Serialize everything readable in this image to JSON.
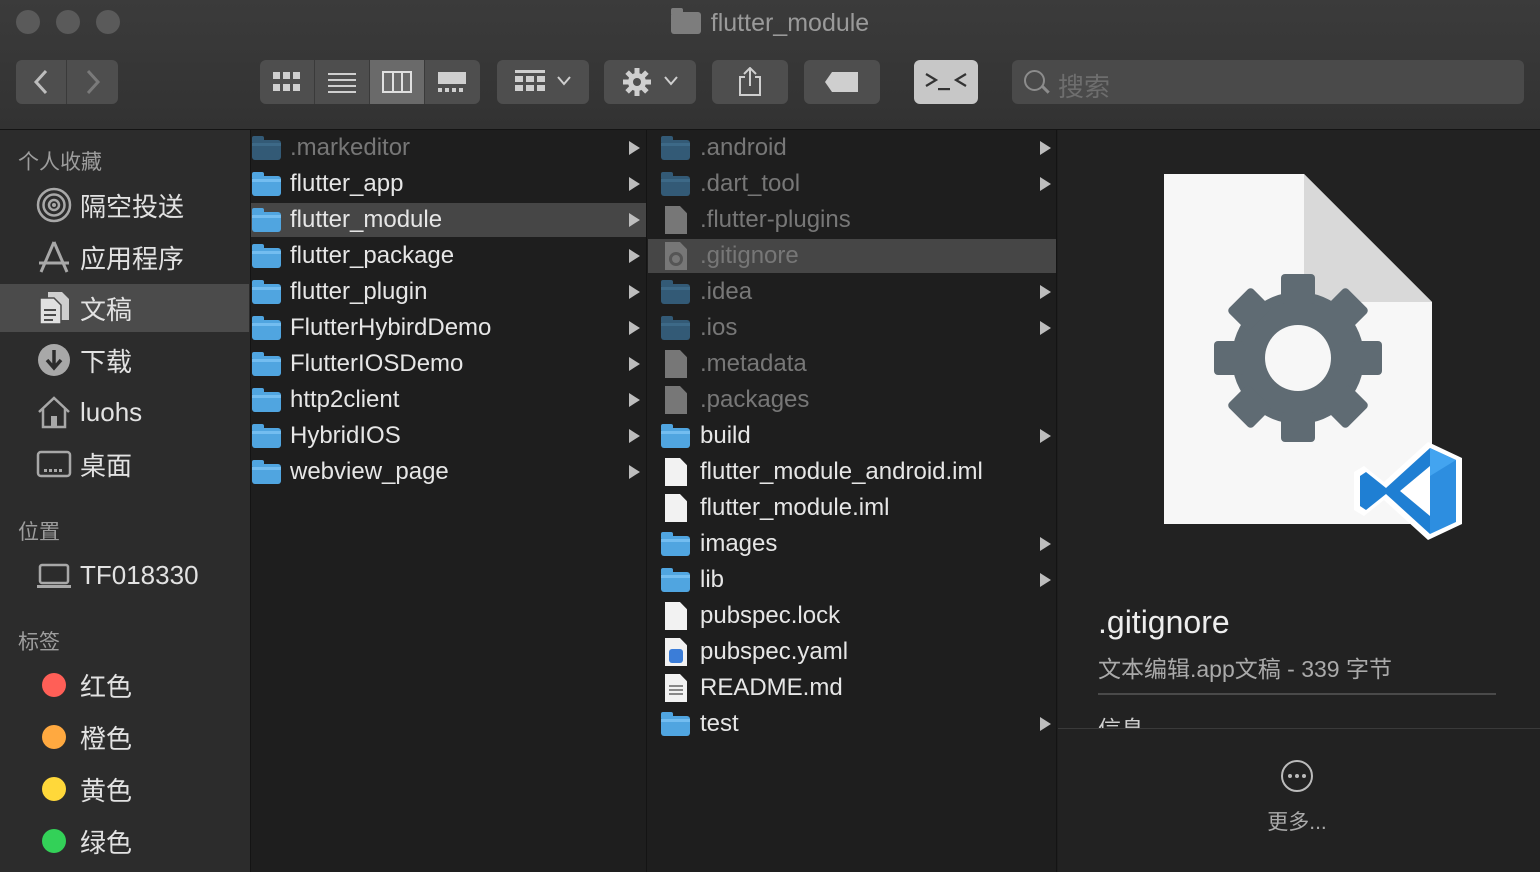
{
  "window": {
    "title": "flutter_module"
  },
  "toolbar": {
    "back_icon": "chevron-left",
    "forward_icon": "chevron-right",
    "view_modes": [
      "icon-view",
      "list-view",
      "column-view",
      "gallery-view"
    ],
    "selected_view": "column-view",
    "search_placeholder": "搜索"
  },
  "sidebar": {
    "favorites_header": "个人收藏",
    "favorites": [
      {
        "label": "隔空投送",
        "icon": "airdrop-icon"
      },
      {
        "label": "应用程序",
        "icon": "applications-icon"
      },
      {
        "label": "文稿",
        "icon": "documents-icon",
        "selected": true
      },
      {
        "label": "下载",
        "icon": "downloads-icon"
      },
      {
        "label": "luohs",
        "icon": "home-icon"
      },
      {
        "label": "桌面",
        "icon": "desktop-icon"
      }
    ],
    "locations_header": "位置",
    "locations": [
      {
        "label": "TF018330",
        "icon": "laptop-icon"
      }
    ],
    "tags_header": "标签",
    "tags": [
      {
        "label": "红色",
        "color": "#ff5f57"
      },
      {
        "label": "橙色",
        "color": "#ffa940"
      },
      {
        "label": "黄色",
        "color": "#ffd83a"
      },
      {
        "label": "绿色",
        "color": "#33d158"
      }
    ]
  },
  "column1": [
    {
      "name": ".markeditor",
      "type": "folder",
      "hidden": true,
      "arrow": true
    },
    {
      "name": "flutter_app",
      "type": "folder",
      "arrow": true
    },
    {
      "name": "flutter_module",
      "type": "folder",
      "arrow": true,
      "selected": true
    },
    {
      "name": "flutter_package",
      "type": "folder",
      "arrow": true
    },
    {
      "name": "flutter_plugin",
      "type": "folder",
      "arrow": true
    },
    {
      "name": "FlutterHybirdDemo",
      "type": "folder",
      "arrow": true
    },
    {
      "name": "FlutterIOSDemo",
      "type": "folder",
      "arrow": true
    },
    {
      "name": "http2client",
      "type": "folder",
      "arrow": true
    },
    {
      "name": "HybridIOS",
      "type": "folder",
      "arrow": true
    },
    {
      "name": "webview_page",
      "type": "folder",
      "arrow": true
    }
  ],
  "column2": [
    {
      "name": ".android",
      "type": "folder",
      "hidden": true,
      "arrow": true
    },
    {
      "name": ".dart_tool",
      "type": "folder",
      "hidden": true,
      "arrow": true
    },
    {
      "name": ".flutter-plugins",
      "type": "file",
      "hidden": true
    },
    {
      "name": ".gitignore",
      "type": "config-file",
      "hidden": true,
      "selected": true
    },
    {
      "name": ".idea",
      "type": "folder",
      "hidden": true,
      "arrow": true
    },
    {
      "name": ".ios",
      "type": "folder",
      "hidden": true,
      "arrow": true
    },
    {
      "name": ".metadata",
      "type": "file",
      "hidden": true
    },
    {
      "name": ".packages",
      "type": "file",
      "hidden": true
    },
    {
      "name": "build",
      "type": "folder",
      "arrow": true
    },
    {
      "name": "flutter_module_android.iml",
      "type": "file"
    },
    {
      "name": "flutter_module.iml",
      "type": "file"
    },
    {
      "name": "images",
      "type": "folder",
      "arrow": true
    },
    {
      "name": "lib",
      "type": "folder",
      "arrow": true
    },
    {
      "name": "pubspec.lock",
      "type": "file"
    },
    {
      "name": "pubspec.yaml",
      "type": "yaml-file"
    },
    {
      "name": "README.md",
      "type": "markdown-file"
    },
    {
      "name": "test",
      "type": "folder",
      "arrow": true
    }
  ],
  "preview": {
    "filename": ".gitignore",
    "kind": "文本编辑.app文稿 - 339 字节",
    "info_header": "信息",
    "more_label": "更多..."
  }
}
